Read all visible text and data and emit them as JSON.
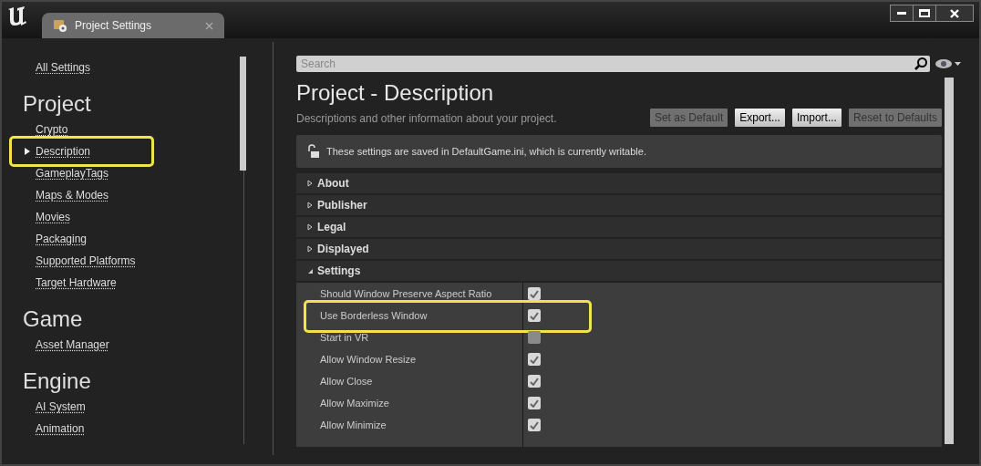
{
  "window": {
    "tab_title": "Project Settings"
  },
  "sidebar": {
    "all_settings": "All Settings",
    "groups": [
      {
        "heading": "Project",
        "items": [
          {
            "label": "Crypto",
            "selected": false,
            "highlighted": false
          },
          {
            "label": "Description",
            "selected": true,
            "highlighted": true
          },
          {
            "label": "GameplayTags",
            "selected": false,
            "highlighted": false
          },
          {
            "label": "Maps & Modes",
            "selected": false,
            "highlighted": false
          },
          {
            "label": "Movies",
            "selected": false,
            "highlighted": false
          },
          {
            "label": "Packaging",
            "selected": false,
            "highlighted": false
          },
          {
            "label": "Supported Platforms",
            "selected": false,
            "highlighted": false
          },
          {
            "label": "Target Hardware",
            "selected": false,
            "highlighted": false
          }
        ]
      },
      {
        "heading": "Game",
        "items": [
          {
            "label": "Asset Manager",
            "selected": false,
            "highlighted": false
          }
        ]
      },
      {
        "heading": "Engine",
        "items": [
          {
            "label": "AI System",
            "selected": false,
            "highlighted": false
          },
          {
            "label": "Animation",
            "selected": false,
            "highlighted": false
          }
        ]
      }
    ]
  },
  "search": {
    "placeholder": "Search"
  },
  "page": {
    "title": "Project - Description",
    "subtitle": "Descriptions and other information about your project.",
    "buttons": [
      {
        "label": "Set as Default",
        "disabled": true
      },
      {
        "label": "Export...",
        "disabled": false
      },
      {
        "label": "Import...",
        "disabled": false
      },
      {
        "label": "Reset to Defaults",
        "disabled": true
      }
    ],
    "notice": "These settings are saved in DefaultGame.ini, which is currently writable."
  },
  "sections": [
    {
      "label": "About",
      "expanded": false
    },
    {
      "label": "Publisher",
      "expanded": false
    },
    {
      "label": "Legal",
      "expanded": false
    },
    {
      "label": "Displayed",
      "expanded": false
    },
    {
      "label": "Settings",
      "expanded": true,
      "properties": [
        {
          "label": "Should Window Preserve Aspect Ratio",
          "checked": true,
          "highlighted": false
        },
        {
          "label": "Use Borderless Window",
          "checked": true,
          "highlighted": true
        },
        {
          "label": "Start in VR",
          "checked": false,
          "highlighted": false
        },
        {
          "label": "Allow Window Resize",
          "checked": true,
          "highlighted": false
        },
        {
          "label": "Allow Close",
          "checked": true,
          "highlighted": false
        },
        {
          "label": "Allow Maximize",
          "checked": true,
          "highlighted": false
        },
        {
          "label": "Allow Minimize",
          "checked": true,
          "highlighted": false
        }
      ]
    }
  ]
}
